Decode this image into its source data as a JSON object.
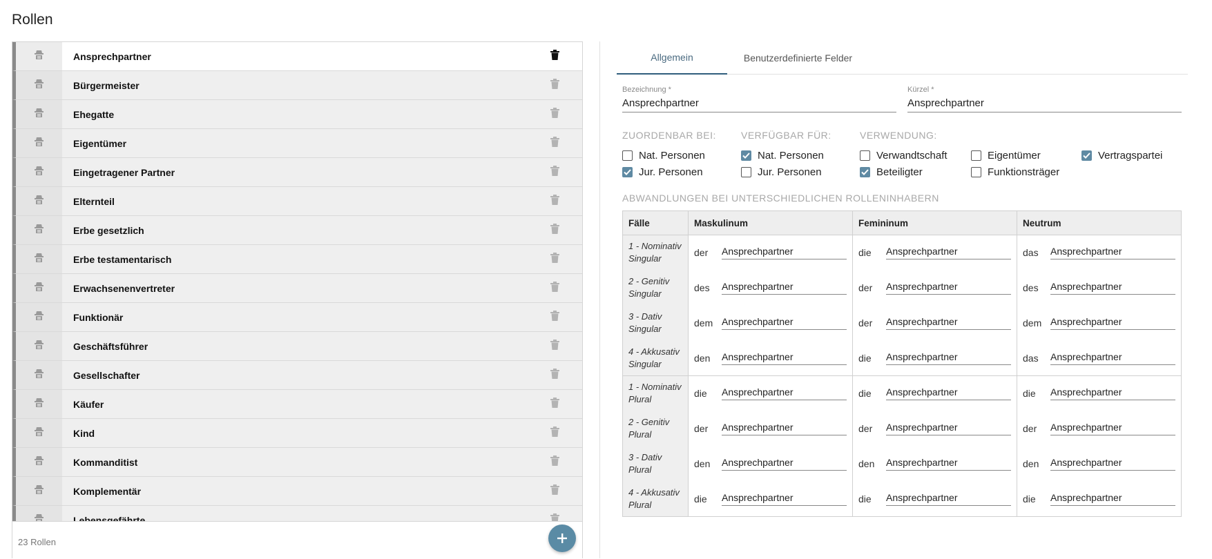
{
  "page": {
    "title": "Rollen"
  },
  "roles": {
    "items": [
      {
        "label": "Ansprechpartner"
      },
      {
        "label": "Bürgermeister"
      },
      {
        "label": "Ehegatte"
      },
      {
        "label": "Eigentümer"
      },
      {
        "label": "Eingetragener Partner"
      },
      {
        "label": "Elternteil"
      },
      {
        "label": "Erbe gesetzlich"
      },
      {
        "label": "Erbe testamentarisch"
      },
      {
        "label": "Erwachsenenvertreter"
      },
      {
        "label": "Funktionär"
      },
      {
        "label": "Geschäftsführer"
      },
      {
        "label": "Gesellschafter"
      },
      {
        "label": "Käufer"
      },
      {
        "label": "Kind"
      },
      {
        "label": "Kommanditist"
      },
      {
        "label": "Komplementär"
      },
      {
        "label": "Lebensgefährte"
      }
    ],
    "selected_index": 0,
    "count_text": "23 Rollen",
    "add_icon": "plus-icon",
    "row_icon": "role-icon",
    "delete_icon": "trash-icon"
  },
  "detail": {
    "tabs": {
      "general": "Allgemein",
      "custom": "Benutzerdefinierte Felder"
    },
    "fields": {
      "name_label": "Bezeichnung *",
      "name_value": "Ansprechpartner",
      "short_label": "Kürzel *",
      "short_value": "Ansprechpartner"
    },
    "sections": {
      "assignable": "ZUORDENBAR BEI:",
      "available": "VERFÜGBAR FÜR:",
      "usage": "VERWENDUNG:",
      "variants": "ABWANDLUNGEN BEI UNTERSCHIEDLICHEN ROLLENINHABERN"
    },
    "checkboxes": {
      "assign_nat": {
        "label": "Nat. Personen",
        "checked": false
      },
      "assign_jur": {
        "label": "Jur. Personen",
        "checked": true
      },
      "avail_nat": {
        "label": "Nat. Personen",
        "checked": true
      },
      "avail_jur": {
        "label": "Jur. Personen",
        "checked": false
      },
      "use_kinship": {
        "label": "Verwandtschaft",
        "checked": false
      },
      "use_involved": {
        "label": "Beteiligter",
        "checked": true
      },
      "use_owner": {
        "label": "Eigentümer",
        "checked": false
      },
      "use_functionary": {
        "label": "Funktionsträger",
        "checked": false
      },
      "use_party": {
        "label": "Vertragspartei",
        "checked": true
      }
    },
    "table": {
      "headers": {
        "cases": "Fälle",
        "masc": "Maskulinum",
        "fem": "Femininum",
        "neut": "Neutrum"
      },
      "rows": [
        {
          "case": "1 - Nominativ Singular",
          "masc_art": "der",
          "masc": "Ansprechpartner",
          "fem_art": "die",
          "fem": "Ansprechpartner",
          "neut_art": "das",
          "neut": "Ansprechpartner"
        },
        {
          "case": "2 - Genitiv Singular",
          "masc_art": "des",
          "masc": "Ansprechpartner",
          "fem_art": "der",
          "fem": "Ansprechpartner",
          "neut_art": "des",
          "neut": "Ansprechpartner"
        },
        {
          "case": "3 - Dativ Singular",
          "masc_art": "dem",
          "masc": "Ansprechpartner",
          "fem_art": "der",
          "fem": "Ansprechpartner",
          "neut_art": "dem",
          "neut": "Ansprechpartner"
        },
        {
          "case": "4 - Akkusativ Singular",
          "masc_art": "den",
          "masc": "Ansprechpartner",
          "fem_art": "die",
          "fem": "Ansprechpartner",
          "neut_art": "das",
          "neut": "Ansprechpartner"
        },
        {
          "case": "1 - Nominativ Plural",
          "masc_art": "die",
          "masc": "Ansprechpartner",
          "fem_art": "die",
          "fem": "Ansprechpartner",
          "neut_art": "die",
          "neut": "Ansprechpartner"
        },
        {
          "case": "2 - Genitiv Plural",
          "masc_art": "der",
          "masc": "Ansprechpartner",
          "fem_art": "der",
          "fem": "Ansprechpartner",
          "neut_art": "der",
          "neut": "Ansprechpartner"
        },
        {
          "case": "3 - Dativ Plural",
          "masc_art": "den",
          "masc": "Ansprechpartner",
          "fem_art": "den",
          "fem": "Ansprechpartner",
          "neut_art": "den",
          "neut": "Ansprechpartner"
        },
        {
          "case": "4 - Akkusativ Plural",
          "masc_art": "die",
          "masc": "Ansprechpartner",
          "fem_art": "die",
          "fem": "Ansprechpartner",
          "neut_art": "die",
          "neut": "Ansprechpartner"
        }
      ]
    }
  },
  "colors": {
    "accent": "#5a8ba5",
    "checkbox_checked": "#5f8aa3",
    "tab_indicator": "#2f5d7c",
    "row_stripe": "#8a8a8a"
  }
}
